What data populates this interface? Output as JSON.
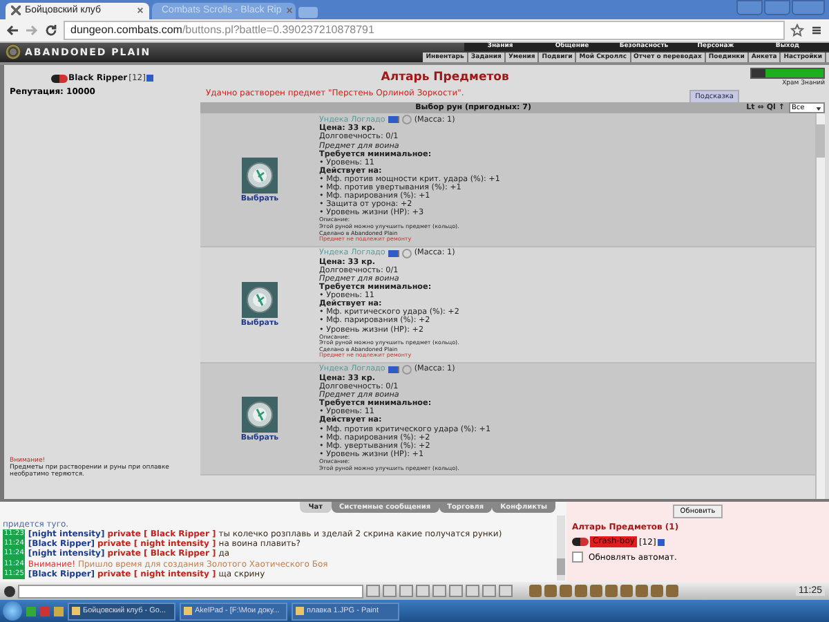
{
  "browser": {
    "tabs": [
      {
        "title": "Бойцовский клуб",
        "selected": true
      },
      {
        "title": "Combats Scrolls - Black Rip",
        "selected": false
      }
    ],
    "url_host": "dungeon.combats.com",
    "url_path": "/buttons.pl?battle=0.390237210878791"
  },
  "game_header": {
    "logo": "ABANDONED PLAIN",
    "top_menu": [
      "Знания",
      "Общение",
      "Безопасность",
      "Персонаж",
      "Выход"
    ],
    "sub_menu": [
      "Инвентарь",
      "Задания",
      "Умения",
      "Подвиги",
      "Мой Скроллс",
      "Отчет о переводах",
      "Поединки",
      "Анкета",
      "Настройки"
    ]
  },
  "character": {
    "name": "Black Ripper",
    "level": "[12]",
    "reputation": "Репутация: 10000"
  },
  "warning": {
    "title": "Внимание!",
    "text": "Предметы при растворении и руны при оплавке необратимо теряются."
  },
  "altar": {
    "title": "Алтарь Предметов",
    "message": "Удачно растворен предмет \"Перстень Орлиной Зоркости\".",
    "hint_button": "Подсказка",
    "list_title": "Выбор рун (пригодных: 7)",
    "sort_controls": [
      "Lt",
      "⇔",
      "Ql",
      "↑"
    ],
    "filter": "Все"
  },
  "status": {
    "hp_bar": {
      "level": 0.8
    },
    "location_link": "Храм Знаний"
  },
  "runes": [
    {
      "name": "Ундека Логладо",
      "mass": "(Масса: 1)",
      "price": "Цена: 33 кр.",
      "durability": "Долговечность: 0/1",
      "class_note": "Предмет для воина",
      "requires_label": "Требуется минимальное:",
      "requires": [
        "• Уровень: 11"
      ],
      "effects_label": "Действует на:",
      "effects": [
        "• Мф. против мощности крит. удара (%): +1",
        "• Мф. против увертывания (%): +1",
        "• Мф. парирования (%): +1",
        "• Защита от урона: +2",
        "• Уровень жизни (HP): +3"
      ],
      "description_label": "Описание:",
      "description": "Этой руной можно улучшить предмет (кольцо).",
      "made": "Сделано в Abandoned Plain",
      "repair_note": "Предмет не подлежит ремонту",
      "button": "Выбрать"
    },
    {
      "name": "Ундека Логладо",
      "mass": "(Масса: 1)",
      "price": "Цена: 33 кр.",
      "durability": "Долговечность: 0/1",
      "class_note": "Предмет для воина",
      "requires_label": "Требуется минимальное:",
      "requires": [
        "• Уровень: 11"
      ],
      "effects_label": "Действует на:",
      "effects": [
        "• Мф. критического удара (%): +2",
        "• Мф. парирования (%): +2",
        "• Уровень жизни (HP): +2"
      ],
      "description_label": "Описание:",
      "description": "Этой руной можно улучшить предмет (кольцо).",
      "made": "Сделано в Abandoned Plain",
      "repair_note": "Предмет не подлежит ремонту",
      "button": "Выбрать"
    },
    {
      "name": "Ундека Логладо",
      "mass": "(Масса: 1)",
      "price": "Цена: 33 кр.",
      "durability": "Долговечность: 0/1",
      "class_note": "Предмет для воина",
      "requires_label": "Требуется минимальное:",
      "requires": [
        "• Уровень: 11"
      ],
      "effects_label": "Действует на:",
      "effects": [
        "• Мф. против критического удара (%): +1",
        "• Мф. парирования (%): +2",
        "• Мф. увертывания (%): +2",
        "• Уровень жизни (HP): +1"
      ],
      "description_label": "Описание:",
      "description": "Этой руной можно улучшить предмет (кольцо).",
      "button": "Выбрать"
    }
  ],
  "chat": {
    "tabs": [
      {
        "label": "Чат",
        "selected": true
      },
      {
        "label": "Системные сообщения",
        "selected": false
      },
      {
        "label": "Торговля",
        "selected": false
      },
      {
        "label": "Конфликты",
        "selected": false
      }
    ],
    "lines": [
      {
        "kind": "text",
        "text": "придется туго."
      },
      {
        "kind": "private",
        "time": "11:23",
        "from": "[night intensity]",
        "to": "private [ Black Ripper ]",
        "text": "ты колечко розплавь и зделай 2 скрина какие получатся рунки)"
      },
      {
        "kind": "private",
        "time": "11:24",
        "from": "[Black Ripper]",
        "to": "private [ night intensity ]",
        "text": "на воина плавить?"
      },
      {
        "kind": "private",
        "time": "11:24",
        "from": "[night intensity]",
        "to": "private [ Black Ripper ]",
        "text": "да"
      },
      {
        "kind": "system",
        "time": "11:24",
        "label": "Внимание!",
        "text": "Пришло время для создания Золотого Хаотического Боя"
      },
      {
        "kind": "private",
        "time": "11:25",
        "from": "[Black Ripper]",
        "to": "private [ night intensity ]",
        "text": "ща скрину"
      }
    ]
  },
  "room": {
    "refresh_button": "Обновить",
    "title": "Алтарь Предметов (1)",
    "users": [
      {
        "name": "Crash-boy",
        "level": "[12]",
        "highlighted": true
      }
    ],
    "auto_refresh": {
      "label": "Обновлять автомат.",
      "checked": false
    }
  },
  "chat_bar": {
    "time": "11:25"
  },
  "taskbar": {
    "tasks": [
      {
        "title": "Бойцовский клуб - Go...",
        "selected": true
      },
      {
        "title": "AkelPad - [F:\\Мои доку...",
        "selected": false
      },
      {
        "title": "плавка 1.JPG - Paint",
        "selected": false
      }
    ]
  }
}
